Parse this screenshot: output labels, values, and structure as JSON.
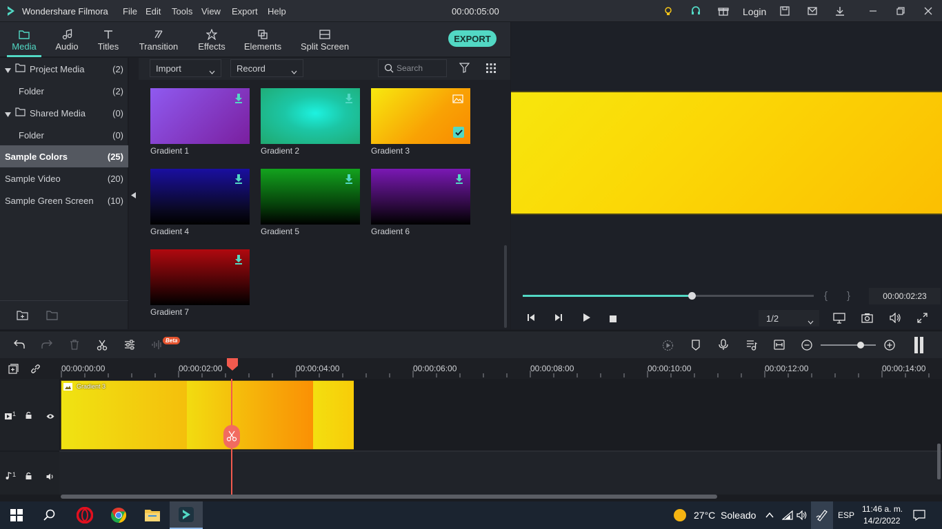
{
  "app": {
    "title": "Wondershare Filmora",
    "timecode": "00:00:05:00",
    "login": "Login"
  },
  "menu": [
    "File",
    "Edit",
    "Tools",
    "View",
    "Export",
    "Help"
  ],
  "tabs": [
    {
      "label": "Media",
      "icon": "folder-icon",
      "active": true
    },
    {
      "label": "Audio",
      "icon": "music-note-icon"
    },
    {
      "label": "Titles",
      "icon": "text-T-icon"
    },
    {
      "label": "Transition",
      "icon": "transition-icon"
    },
    {
      "label": "Effects",
      "icon": "effects-icon"
    },
    {
      "label": "Elements",
      "icon": "elements-icon"
    },
    {
      "label": "Split Screen",
      "icon": "split-screen-icon"
    }
  ],
  "export_label": "EXPORT",
  "sidebar": {
    "items": [
      {
        "label": "Project Media",
        "count": "(2)"
      },
      {
        "label": "Folder",
        "count": "(2)"
      },
      {
        "label": "Shared Media",
        "count": "(0)"
      },
      {
        "label": "Folder",
        "count": "(0)"
      },
      {
        "label": "Sample Colors",
        "count": "(25)"
      },
      {
        "label": "Sample Video",
        "count": "(20)"
      },
      {
        "label": "Sample Green Screen",
        "count": "(10)"
      }
    ]
  },
  "media": {
    "import_label": "Import",
    "record_label": "Record",
    "search_placeholder": "Search",
    "items": [
      {
        "label": "Gradient 1"
      },
      {
        "label": "Gradient 2"
      },
      {
        "label": "Gradient 3"
      },
      {
        "label": "Gradient 4"
      },
      {
        "label": "Gradient 5"
      },
      {
        "label": "Gradient 6"
      },
      {
        "label": "Gradient 7"
      }
    ]
  },
  "player": {
    "timecode": "00:00:02:23",
    "quality": "1/2",
    "progress": 0.58
  },
  "timeline": {
    "ruler": [
      "00:00:00:00",
      "00:00:02:00",
      "00:00:04:00",
      "00:00:06:00",
      "00:00:08:00",
      "00:00:10:00",
      "00:00:12:00",
      "00:00:14:00"
    ],
    "clip_label": "Gradient 3",
    "beta": "Beta",
    "video_track": "1",
    "audio_track": "1"
  },
  "taskbar": {
    "weather": "27°C  Soleado",
    "lang": "ESP",
    "time": "11:46 a. m.",
    "date": "14/2/2022"
  },
  "colors": {
    "accent": "#52d8c4",
    "playhead": "#f25a4e"
  }
}
